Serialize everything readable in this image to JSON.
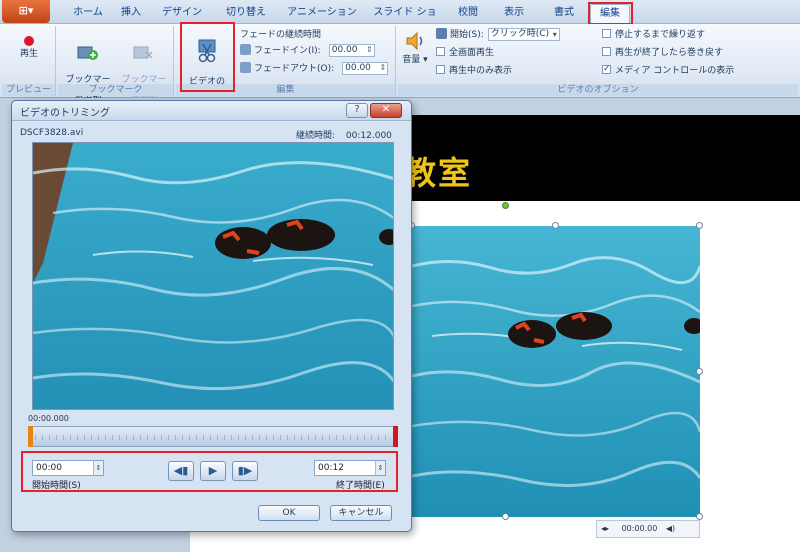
{
  "app": {
    "office_button": "Office",
    "tabs": [
      {
        "label": "ホーム"
      },
      {
        "label": "挿入"
      },
      {
        "label": "デザイン"
      },
      {
        "label": "切り替え"
      },
      {
        "label": "アニメーション"
      },
      {
        "label": "スライド ショー"
      },
      {
        "label": "校閲"
      },
      {
        "label": "表示"
      },
      {
        "label": "書式"
      },
      {
        "label": "編集"
      }
    ],
    "active_tab": "編集"
  },
  "ribbon": {
    "preview": {
      "play_label": "再生",
      "group_label": "プレビュー"
    },
    "bookmark": {
      "add_label": "ブックマーク\nの追加",
      "remove_label": "ブックマーク\nの削除",
      "group_label": "ブックマーク"
    },
    "edit": {
      "trim_label": "ビデオの\nトリミング",
      "fade_title": "フェードの継続時間",
      "fade_in_label": "フェードイン(I):",
      "fade_in_value": "00.00",
      "fade_out_label": "フェードアウト(O):",
      "fade_out_value": "00.00",
      "group_label": "編集"
    },
    "options": {
      "volume_label": "音量",
      "start_label": "開始(S):",
      "start_value": "クリック時(C)",
      "fullscreen_label": "全画面再生",
      "hide_label": "再生中のみ表示",
      "loop_label": "停止するまで繰り返す",
      "rewind_label": "再生が終了したら巻き戻す",
      "controls_label": "メディア コントロールの表示",
      "group_label": "ビデオのオプション"
    }
  },
  "slide": {
    "title": "教室",
    "controls_time": "00:00.00"
  },
  "dialog": {
    "title": "ビデオのトリミング",
    "file_name": "DSCF3828.avi",
    "total_label": "継続時間:",
    "total_value": "00:12.000",
    "time_readout": "00:00.000",
    "start_value": "00:00",
    "start_label": "開始時間(S)",
    "end_value": "00:12",
    "end_label": "終了時間(E)",
    "ok": "OK",
    "cancel": "キャンセル"
  },
  "colors": {
    "highlight": "#e8202a",
    "slide_title": "#f0c419",
    "pool_water": "#2f9cc0"
  }
}
